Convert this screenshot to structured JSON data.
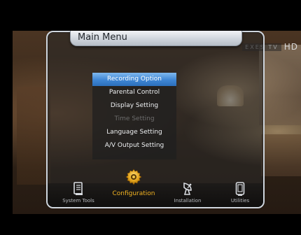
{
  "title": "Main Menu",
  "channel_logo": {
    "brand": "EXES TV",
    "hd": "HD"
  },
  "submenu": [
    {
      "label": "Recording Option",
      "state": "selected"
    },
    {
      "label": "Parental Control",
      "state": "normal"
    },
    {
      "label": "Display Setting",
      "state": "normal"
    },
    {
      "label": "Time Setting",
      "state": "disabled"
    },
    {
      "label": "Language Setting",
      "state": "normal"
    },
    {
      "label": "A/V Output Setting",
      "state": "normal"
    }
  ],
  "toolbar": [
    {
      "label": "System Tools",
      "icon": "document-icon"
    },
    {
      "label": "Configuration",
      "icon": "gear-icon",
      "active": true
    },
    {
      "label": "Installation",
      "icon": "satellite-dish-icon"
    },
    {
      "label": "Utilities",
      "icon": "tablet-icon"
    }
  ],
  "colors": {
    "accent": "#3e86d4",
    "active_label": "#f2b321",
    "panel_border": "#cfd6de"
  }
}
